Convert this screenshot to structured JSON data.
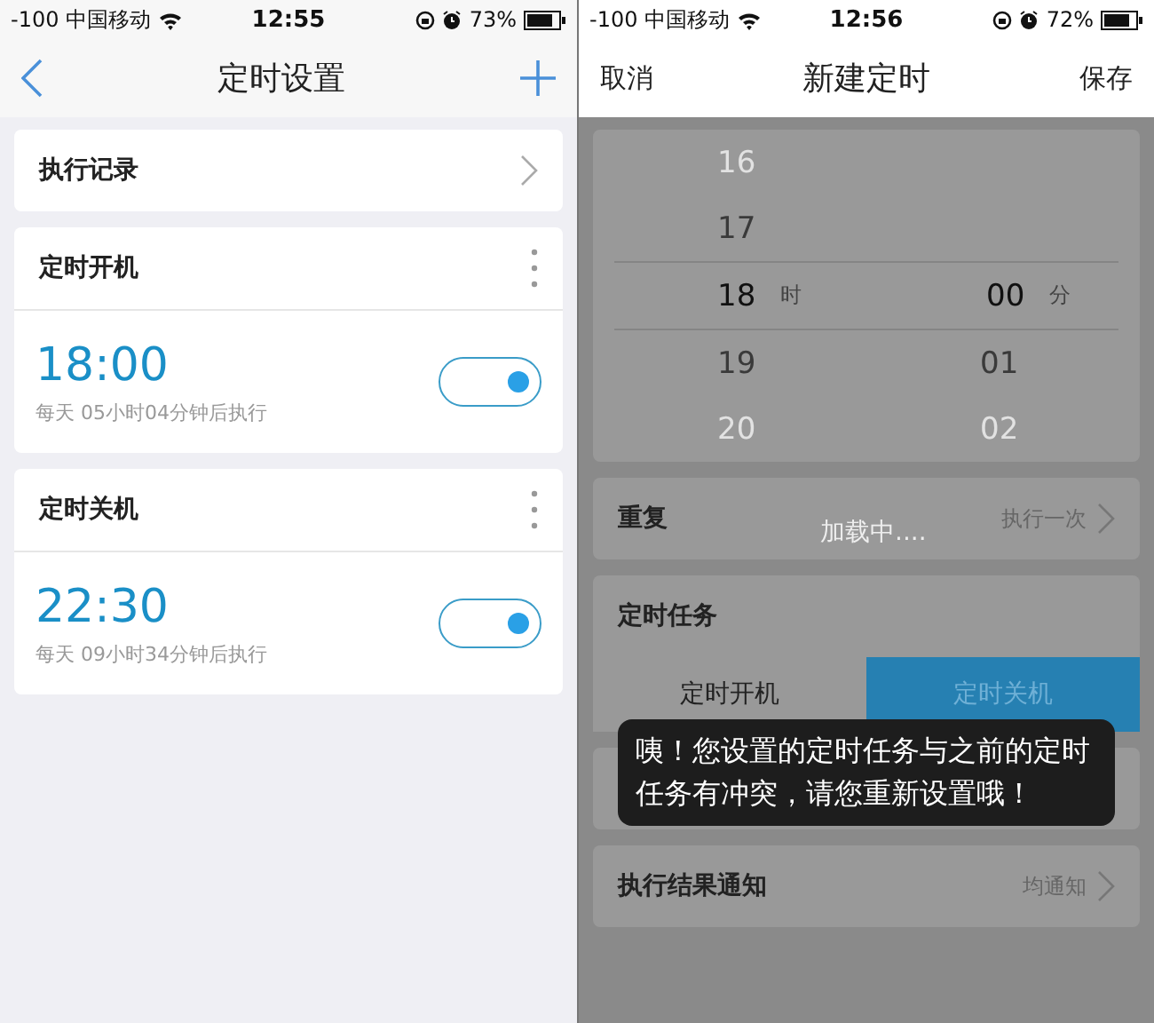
{
  "left_screen": {
    "status_bar": {
      "carrier": "-100 中国移动",
      "time": "12:55",
      "battery": "73%"
    },
    "nav": {
      "title": "定时设置"
    },
    "history_row": {
      "label": "执行记录"
    },
    "schedules": [
      {
        "title": "定时开机",
        "time": "18:00",
        "note": "每天 05小时04分钟后执行",
        "on": true
      },
      {
        "title": "定时关机",
        "time": "22:30",
        "note": "每天 09小时34分钟后执行",
        "on": true
      }
    ]
  },
  "right_screen": {
    "status_bar": {
      "carrier": "-100 中国移动",
      "time": "12:56",
      "battery": "72%"
    },
    "nav": {
      "cancel": "取消",
      "title": "新建定时",
      "save": "保存"
    },
    "picker": {
      "hours": [
        {
          "label": "16",
          "selected": false
        },
        {
          "label": "17",
          "selected": false
        },
        {
          "label": "18",
          "selected": true
        },
        {
          "label": "19",
          "selected": false
        },
        {
          "label": "20",
          "selected": false
        }
      ],
      "hour_unit": "时",
      "minutes": [
        {
          "label": "00",
          "selected": true
        },
        {
          "label": "01",
          "selected": false
        },
        {
          "label": "02",
          "selected": false
        }
      ],
      "minute_unit": "分"
    },
    "repeat_row": {
      "label": "重复",
      "value": "执行一次"
    },
    "loading": "加载中....",
    "task": {
      "label": "定时任务",
      "options": [
        {
          "label": "定时开机",
          "selected": false
        },
        {
          "label": "定时关机",
          "selected": true
        }
      ]
    },
    "notify_row": {
      "label": "执行结果通知",
      "value": "均通知"
    },
    "toast": "咦！您设置的定时任务与之前的定时任务有冲突，请您重新设置哦！"
  }
}
